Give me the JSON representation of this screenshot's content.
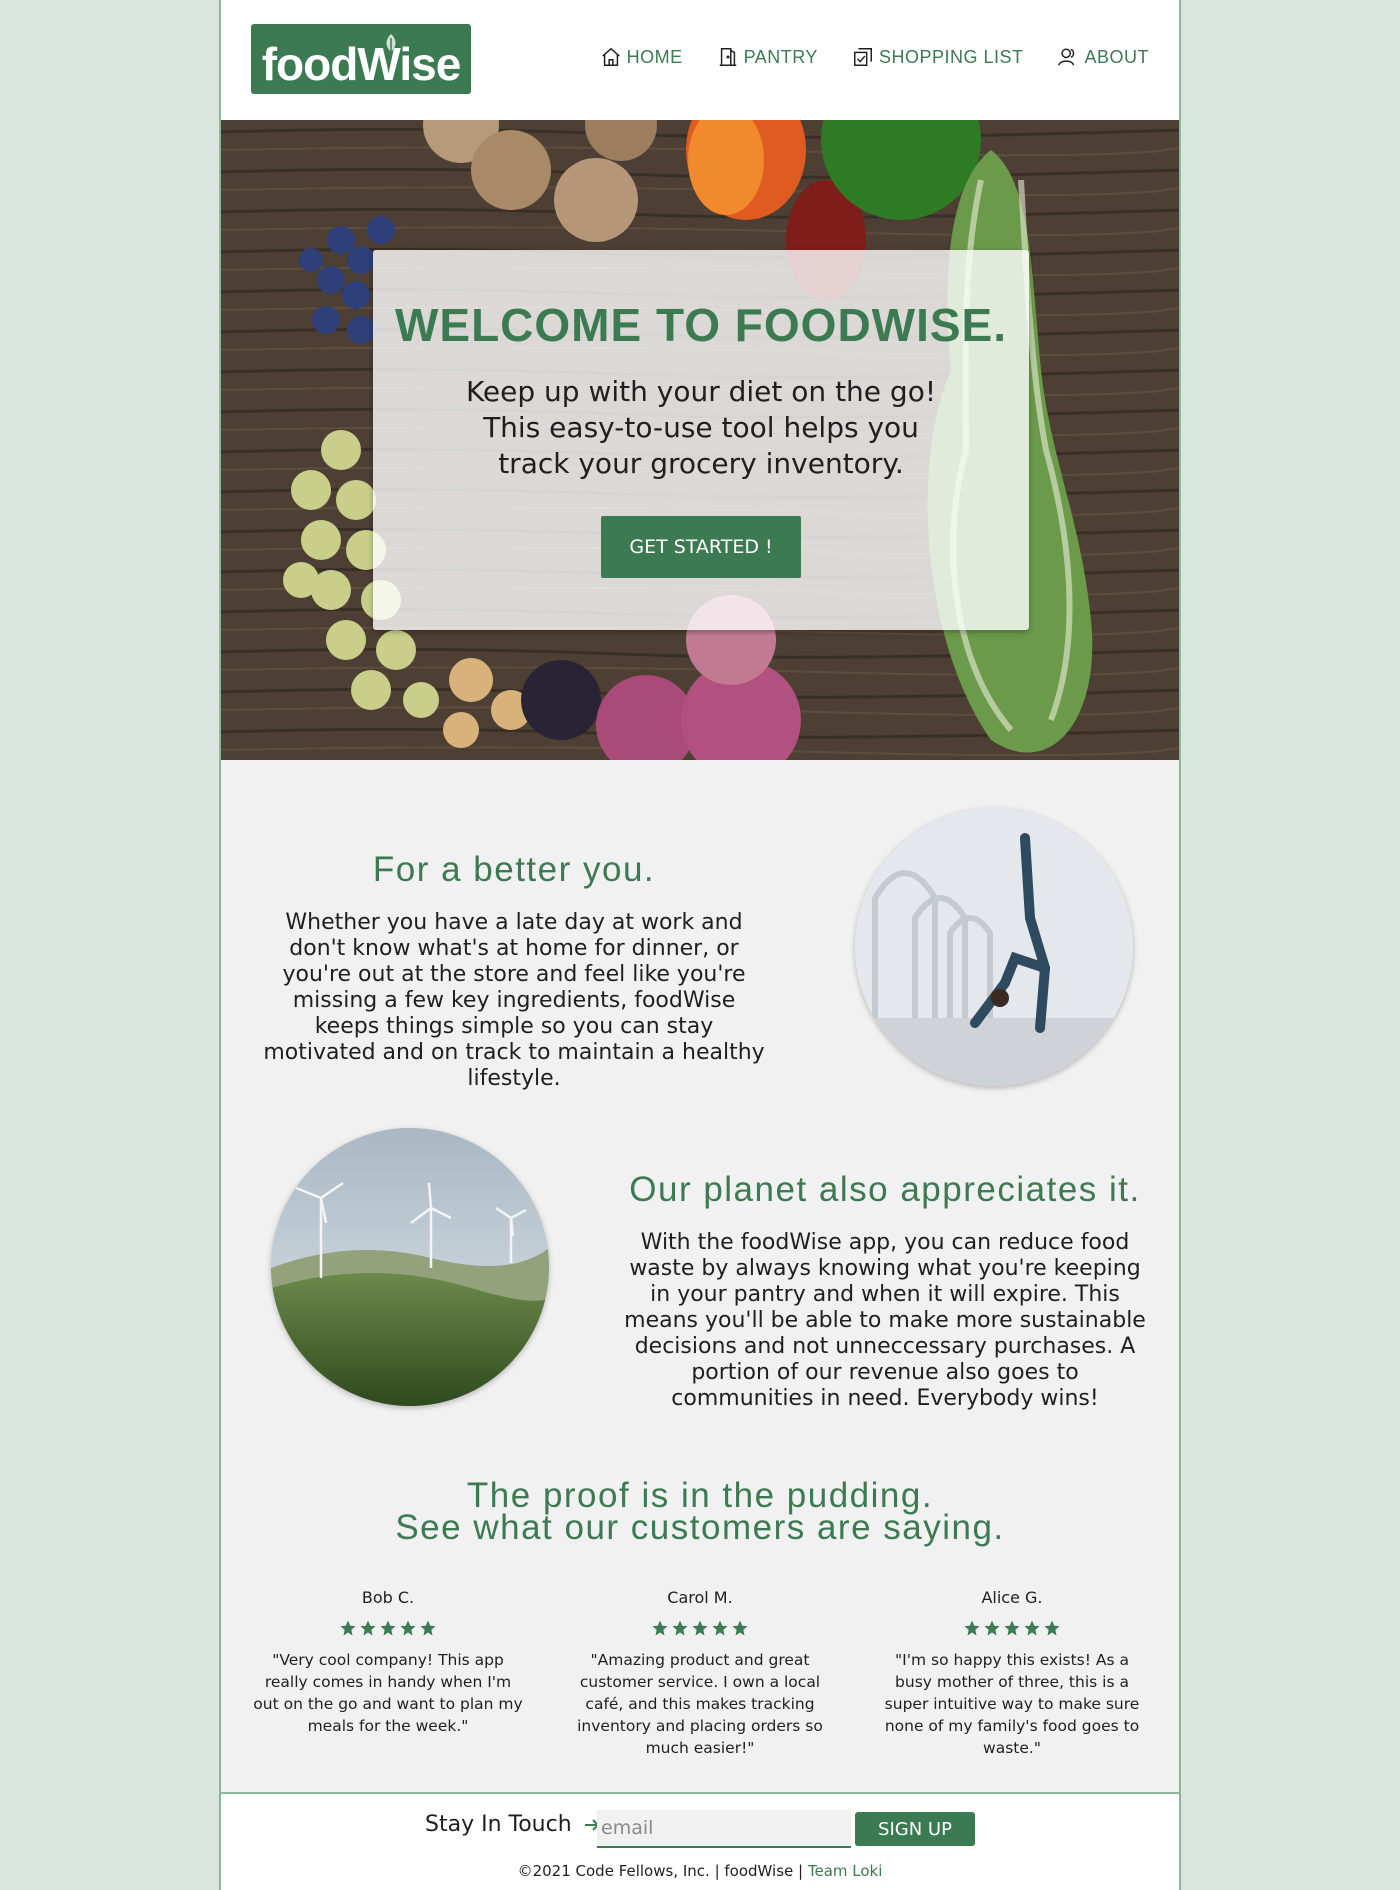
{
  "header": {
    "logo_text": "foodWise",
    "nav": [
      {
        "label": "HOME",
        "icon": "home-icon"
      },
      {
        "label": "PANTRY",
        "icon": "door-icon"
      },
      {
        "label": "SHOPPING LIST",
        "icon": "checklist-icon"
      },
      {
        "label": "ABOUT",
        "icon": "people-icon"
      }
    ]
  },
  "hero": {
    "title": "WELCOME TO FOODWISE.",
    "subtitle": "Keep up with your diet on the go! This easy-to-use tool helps you track your grocery inventory.",
    "cta": "GET STARTED !"
  },
  "section_better": {
    "title": "For a better you.",
    "text": "Whether you have a late day at work and don't know what's at home for dinner, or you're out at the store and feel like you're missing a few key ingredients, foodWise keeps things simple so you can stay motivated and on track to maintain a healthy lifestyle."
  },
  "section_planet": {
    "title": "Our planet also appreciates it.",
    "text": "With the foodWise app, you can reduce food waste by always knowing what you're keeping in your pantry and when it will expire. This means you'll be able to make more sustainable decisions and not unneccessary purchases. A portion of our revenue also goes to communities in need. Everybody wins!"
  },
  "proof": {
    "title_line1": "The proof is in the pudding.",
    "title_line2": "See what our customers are saying."
  },
  "reviews": [
    {
      "name": "Bob C.",
      "stars": 5,
      "quote": "\"Very cool company! This app really comes in handy when I'm out on the go and want to plan my meals for the week.\""
    },
    {
      "name": "Carol M.",
      "stars": 5,
      "quote": "\"Amazing product and great customer service. I own a local café, and this makes tracking inventory and placing orders so much easier!\""
    },
    {
      "name": "Alice G.",
      "stars": 5,
      "quote": "\"I'm so happy this exists! As a busy mother of three, this is a super intuitive way to make sure none of my family's food goes to waste.\""
    }
  ],
  "footer": {
    "stay_label": "Stay In Touch",
    "email_placeholder": "email",
    "signup": "SIGN UP",
    "copyright": "©2021 Code Fellows, Inc. | foodWise | ",
    "team_link": "Team Loki"
  },
  "colors": {
    "brand_green": "#3c7a52",
    "page_bg": "#dae5df",
    "content_bg": "#f1f1f1"
  }
}
